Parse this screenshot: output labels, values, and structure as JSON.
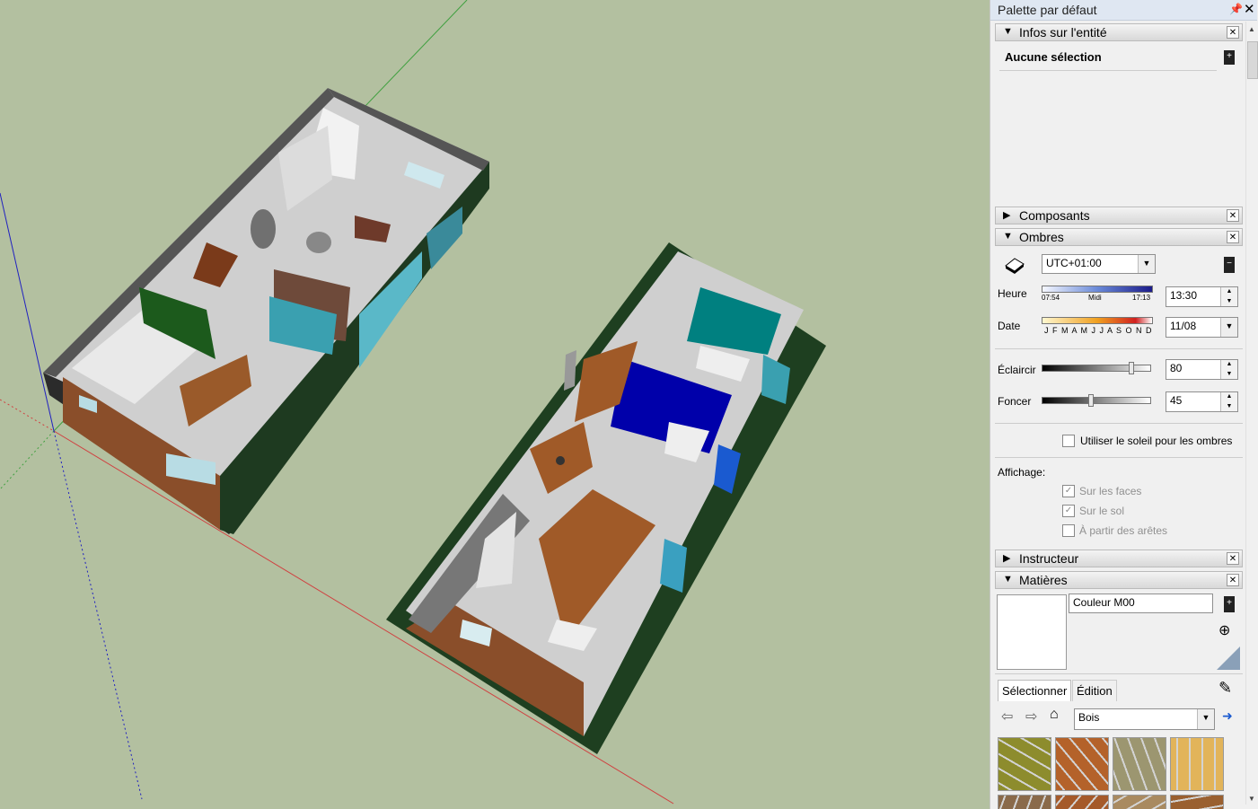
{
  "panel": {
    "title": "Palette par défaut",
    "entity": {
      "section_label": "Infos sur l'entité",
      "selection_text": "Aucune sélection"
    },
    "components": {
      "section_label": "Composants"
    },
    "shadows": {
      "section_label": "Ombres",
      "timezone": "UTC+01:00",
      "time_label": "Heure",
      "time_start": "07:54",
      "time_mid": "Midi",
      "time_end": "17:13",
      "time_value": "13:30",
      "date_label": "Date",
      "months": "J F M A M J J A S O N D",
      "date_value": "11/08",
      "light_label": "Éclaircir",
      "light_value": "80",
      "dark_label": "Foncer",
      "dark_value": "45",
      "sun_checkbox_label": "Utiliser le soleil pour les ombres",
      "display_label": "Affichage:",
      "on_faces_label": "Sur les faces",
      "on_ground_label": "Sur le sol",
      "from_edges_label": "À partir des arêtes",
      "light_level": 0.82,
      "dark_level": 0.45
    },
    "instructor": {
      "section_label": "Instructeur"
    },
    "materials": {
      "section_label": "Matières",
      "material_name": "Couleur M00",
      "tab_select": "Sélectionner",
      "tab_edit": "Édition",
      "library": "Bois",
      "swatch_colors": [
        "#8d8c2d",
        "#b4622a",
        "#9c9670",
        "#e2b45a",
        "#8a6a4a",
        "#a55a2a",
        "#a98a60",
        "#9a6030"
      ]
    }
  },
  "colors": {
    "background": "#b3c0a0",
    "wall_dark_green": "#1f3a1f",
    "wall_grey": "#5a5a5a",
    "floor_wood": "#9a5a2a",
    "floor_light": "#d8d8d8",
    "blue_room": "#0000aa",
    "teal_room": "#00807f",
    "axis_red": "#d04040",
    "axis_green": "#40a040",
    "axis_blue": "#2020c0"
  }
}
